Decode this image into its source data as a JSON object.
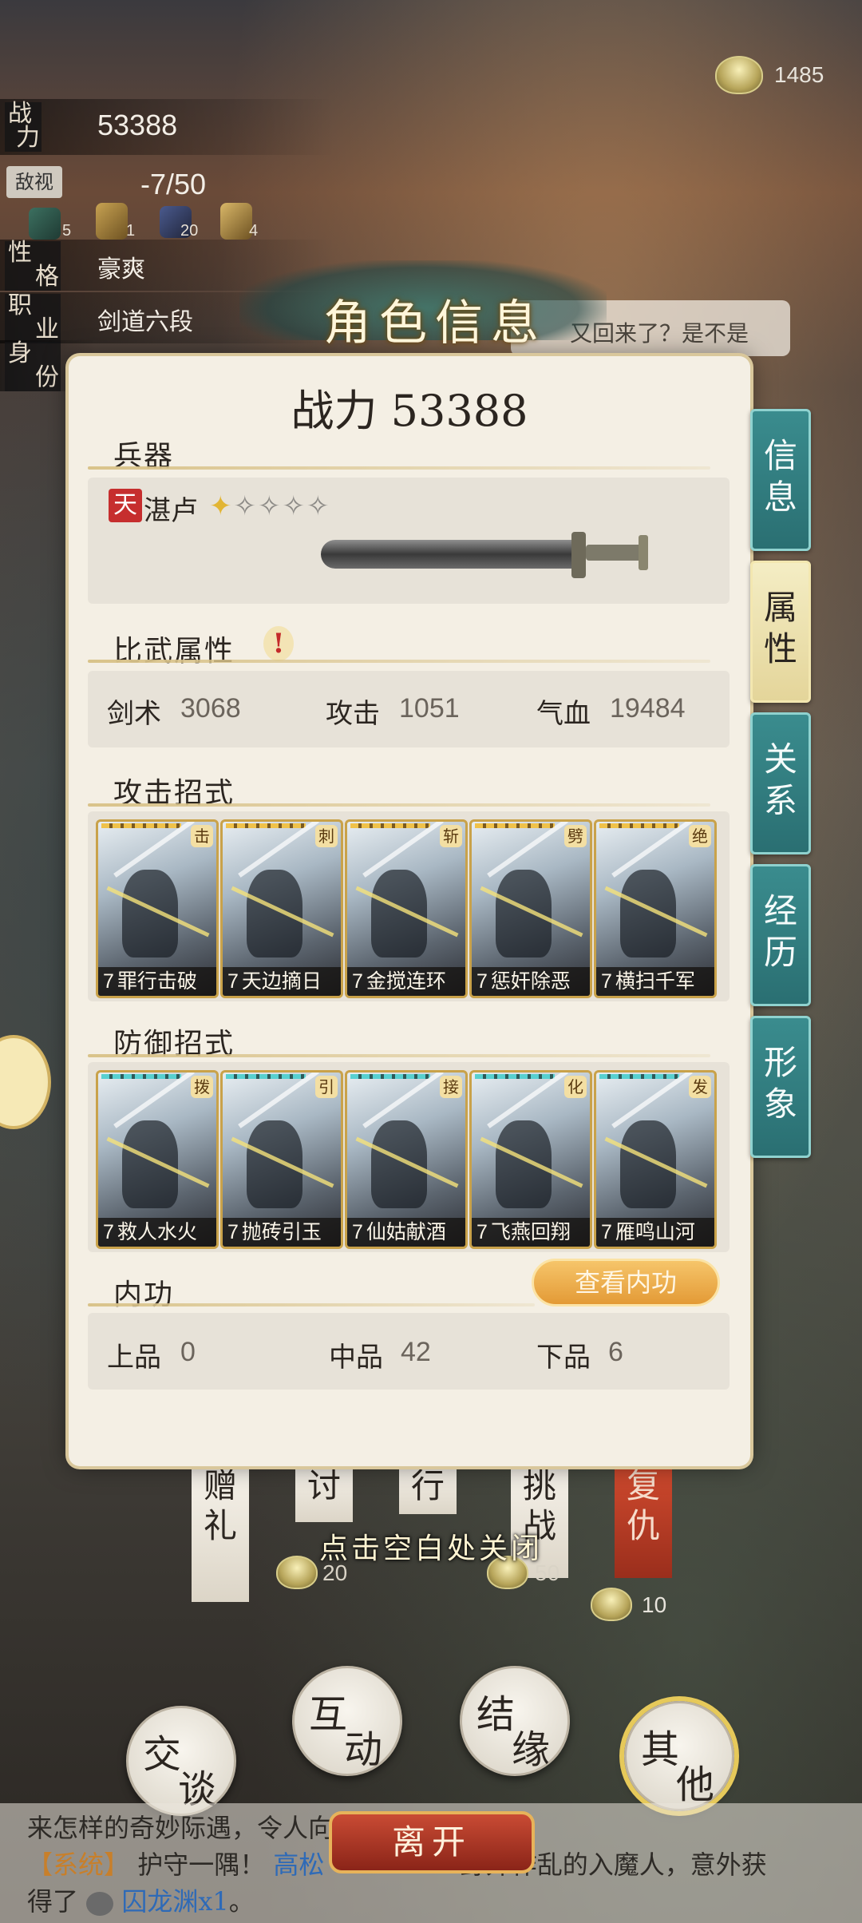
{
  "currency": {
    "amount": "1485",
    "icon": "tea-bowl-icon"
  },
  "character": {
    "power_label": [
      "战",
      "力"
    ],
    "power_value": "53388",
    "hostility_label": "敌视",
    "hostility_value": "-7/50",
    "resources": [
      "5",
      "1",
      "20",
      "4"
    ],
    "personality_label": [
      "性",
      "格"
    ],
    "personality_value": "豪爽",
    "job_label": [
      "职",
      "业"
    ],
    "job_value": "剑道六段",
    "identity_label": [
      "身",
      "份"
    ]
  },
  "dialog_snippet": "又回来了？是不是",
  "panel": {
    "title": "角色信息",
    "power_text": "战力 53388",
    "weapon_section": "兵器",
    "weapon": {
      "rank_badge": "天",
      "name": "湛卢",
      "stars_filled": 1,
      "stars_total": 5
    },
    "duel_section": "比武属性",
    "stats": [
      {
        "key": "剑术",
        "value": "3068"
      },
      {
        "key": "攻击",
        "value": "1051"
      },
      {
        "key": "气血",
        "value": "19484"
      }
    ],
    "attack_section": "攻击招式",
    "attack_cards": [
      {
        "level": "7",
        "name": "罪行击破",
        "tag": "击"
      },
      {
        "level": "7",
        "name": "天边摘日",
        "tag": "刺"
      },
      {
        "level": "7",
        "name": "金搅连环",
        "tag": "斩"
      },
      {
        "level": "7",
        "name": "惩奸除恶",
        "tag": "劈"
      },
      {
        "level": "7",
        "name": "横扫千军",
        "tag": "绝"
      }
    ],
    "defense_section": "防御招式",
    "defense_cards": [
      {
        "level": "7",
        "name": "救人水火",
        "tag": "拨"
      },
      {
        "level": "7",
        "name": "抛砖引玉",
        "tag": "引"
      },
      {
        "level": "7",
        "name": "仙姑献酒",
        "tag": "接"
      },
      {
        "level": "7",
        "name": "飞燕回翔",
        "tag": "化"
      },
      {
        "level": "7",
        "name": "雁鸣山河",
        "tag": "发"
      }
    ],
    "inner_section": "内功",
    "inner_button": "查看内功",
    "inner_stats": [
      {
        "key": "上品",
        "value": "0"
      },
      {
        "key": "中品",
        "value": "42"
      },
      {
        "key": "下品",
        "value": "6"
      }
    ]
  },
  "side_tabs": [
    {
      "top": "信",
      "bottom": "息",
      "active": false
    },
    {
      "top": "属",
      "bottom": "性",
      "active": true
    },
    {
      "top": "关",
      "bottom": "系",
      "active": false
    },
    {
      "top": "经",
      "bottom": "历",
      "active": false
    },
    {
      "top": "形",
      "bottom": "象",
      "active": false
    }
  ],
  "close_hint": "点击空白处关闭",
  "behind_buttons": {
    "gift": [
      "赠",
      "礼"
    ],
    "ask": [
      "讨"
    ],
    "act": [
      "行"
    ],
    "challenge": [
      "挑",
      "战"
    ],
    "revenge": [
      "复",
      "仇"
    ],
    "cost_20": "20",
    "cost_50": "50",
    "cost_10": "10"
  },
  "actions": {
    "talk": [
      "交",
      "谈"
    ],
    "interact": [
      "互",
      "动"
    ],
    "bond": [
      "结",
      "缘"
    ],
    "other": [
      "其",
      "他"
    ],
    "leave": "离开"
  },
  "log": {
    "line1": "来怎样的奇妙际遇，令人向",
    "system_tag": "【系统】",
    "line2_a": "护守一隅！",
    "line2_b": "高松",
    "line2_c": "野外作乱的入魔人，意外获",
    "line3_a": "得了",
    "line3_item": "囚龙渊x1",
    "line3_end": "。"
  }
}
